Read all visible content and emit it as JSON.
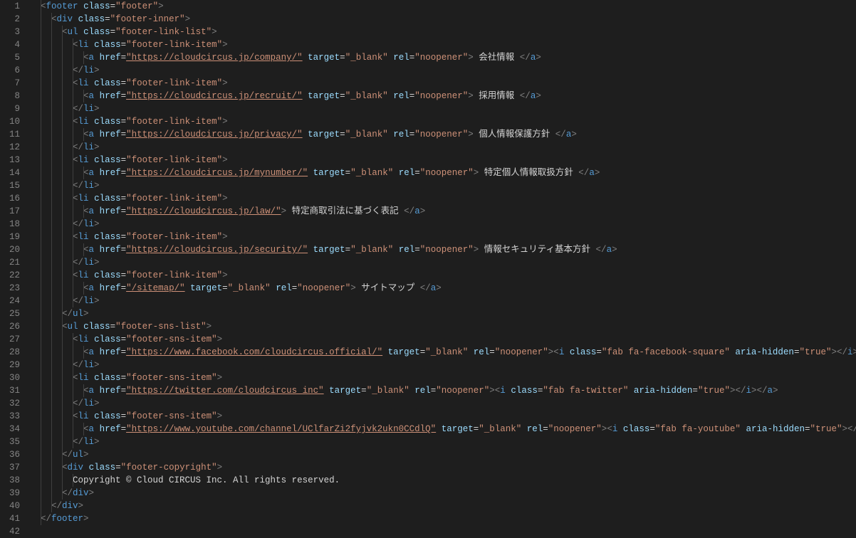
{
  "lines": [
    {
      "num": 1,
      "tokens": [
        {
          "t": "indent",
          "n": 1
        },
        {
          "t": "open",
          "tag": "footer",
          "attrs": [
            [
              "class",
              "footer"
            ]
          ]
        }
      ]
    },
    {
      "num": 2,
      "tokens": [
        {
          "t": "indent",
          "n": 2
        },
        {
          "t": "open",
          "tag": "div",
          "attrs": [
            [
              "class",
              "footer-inner"
            ]
          ]
        }
      ]
    },
    {
      "num": 3,
      "tokens": [
        {
          "t": "indent",
          "n": 3
        },
        {
          "t": "open",
          "tag": "ul",
          "attrs": [
            [
              "class",
              "footer-link-list"
            ]
          ]
        }
      ]
    },
    {
      "num": 4,
      "tokens": [
        {
          "t": "indent",
          "n": 4
        },
        {
          "t": "open",
          "tag": "li",
          "attrs": [
            [
              "class",
              "footer-link-item"
            ]
          ]
        }
      ]
    },
    {
      "num": 5,
      "tokens": [
        {
          "t": "indent",
          "n": 5
        },
        {
          "t": "open",
          "tag": "a",
          "attrs": [
            [
              "href",
              "https://cloudcircus.jp/company/",
              "u"
            ],
            [
              "target",
              "_blank"
            ],
            [
              "rel",
              "noopener"
            ]
          ]
        },
        {
          "t": "txt",
          "v": " 会社情報 "
        },
        {
          "t": "close",
          "tag": "a"
        }
      ]
    },
    {
      "num": 6,
      "tokens": [
        {
          "t": "indent",
          "n": 4
        },
        {
          "t": "close",
          "tag": "li"
        }
      ]
    },
    {
      "num": 7,
      "tokens": [
        {
          "t": "indent",
          "n": 4
        },
        {
          "t": "open",
          "tag": "li",
          "attrs": [
            [
              "class",
              "footer-link-item"
            ]
          ]
        }
      ]
    },
    {
      "num": 8,
      "tokens": [
        {
          "t": "indent",
          "n": 5
        },
        {
          "t": "open",
          "tag": "a",
          "attrs": [
            [
              "href",
              "https://cloudcircus.jp/recruit/",
              "u"
            ],
            [
              "target",
              "_blank"
            ],
            [
              "rel",
              "noopener"
            ]
          ]
        },
        {
          "t": "txt",
          "v": " 採用情報 "
        },
        {
          "t": "close",
          "tag": "a"
        }
      ]
    },
    {
      "num": 9,
      "tokens": [
        {
          "t": "indent",
          "n": 4
        },
        {
          "t": "close",
          "tag": "li"
        }
      ]
    },
    {
      "num": 10,
      "tokens": [
        {
          "t": "indent",
          "n": 4
        },
        {
          "t": "open",
          "tag": "li",
          "attrs": [
            [
              "class",
              "footer-link-item"
            ]
          ]
        }
      ]
    },
    {
      "num": 11,
      "tokens": [
        {
          "t": "indent",
          "n": 5
        },
        {
          "t": "open",
          "tag": "a",
          "attrs": [
            [
              "href",
              "https://cloudcircus.jp/privacy/",
              "u"
            ],
            [
              "target",
              "_blank"
            ],
            [
              "rel",
              "noopener"
            ]
          ]
        },
        {
          "t": "txt",
          "v": " 個人情報保護方針 "
        },
        {
          "t": "close",
          "tag": "a"
        }
      ]
    },
    {
      "num": 12,
      "tokens": [
        {
          "t": "indent",
          "n": 4
        },
        {
          "t": "close",
          "tag": "li"
        }
      ]
    },
    {
      "num": 13,
      "tokens": [
        {
          "t": "indent",
          "n": 4
        },
        {
          "t": "open",
          "tag": "li",
          "attrs": [
            [
              "class",
              "footer-link-item"
            ]
          ]
        }
      ]
    },
    {
      "num": 14,
      "tokens": [
        {
          "t": "indent",
          "n": 5
        },
        {
          "t": "open",
          "tag": "a",
          "attrs": [
            [
              "href",
              "https://cloudcircus.jp/mynumber/",
              "u"
            ],
            [
              "target",
              "_blank"
            ],
            [
              "rel",
              "noopener"
            ]
          ]
        },
        {
          "t": "txt",
          "v": " 特定個人情報取扱方針 "
        },
        {
          "t": "close",
          "tag": "a"
        }
      ]
    },
    {
      "num": 15,
      "tokens": [
        {
          "t": "indent",
          "n": 4
        },
        {
          "t": "close",
          "tag": "li"
        }
      ]
    },
    {
      "num": 16,
      "tokens": [
        {
          "t": "indent",
          "n": 4
        },
        {
          "t": "open",
          "tag": "li",
          "attrs": [
            [
              "class",
              "footer-link-item"
            ]
          ]
        }
      ]
    },
    {
      "num": 17,
      "tokens": [
        {
          "t": "indent",
          "n": 5
        },
        {
          "t": "open",
          "tag": "a",
          "attrs": [
            [
              "href",
              "https://cloudcircus.jp/law/",
              "u"
            ]
          ]
        },
        {
          "t": "txt",
          "v": " 特定商取引法に基づく表記 "
        },
        {
          "t": "close",
          "tag": "a"
        }
      ]
    },
    {
      "num": 18,
      "tokens": [
        {
          "t": "indent",
          "n": 4
        },
        {
          "t": "close",
          "tag": "li"
        }
      ]
    },
    {
      "num": 19,
      "tokens": [
        {
          "t": "indent",
          "n": 4
        },
        {
          "t": "open",
          "tag": "li",
          "attrs": [
            [
              "class",
              "footer-link-item"
            ]
          ]
        }
      ]
    },
    {
      "num": 20,
      "tokens": [
        {
          "t": "indent",
          "n": 5
        },
        {
          "t": "open",
          "tag": "a",
          "attrs": [
            [
              "href",
              "https://cloudcircus.jp/security/",
              "u"
            ],
            [
              "target",
              "_blank"
            ],
            [
              "rel",
              "noopener"
            ]
          ]
        },
        {
          "t": "txt",
          "v": " 情報セキュリティ基本方針 "
        },
        {
          "t": "close",
          "tag": "a"
        }
      ]
    },
    {
      "num": 21,
      "tokens": [
        {
          "t": "indent",
          "n": 4
        },
        {
          "t": "close",
          "tag": "li"
        }
      ]
    },
    {
      "num": 22,
      "tokens": [
        {
          "t": "indent",
          "n": 4
        },
        {
          "t": "open",
          "tag": "li",
          "attrs": [
            [
              "class",
              "footer-link-item"
            ]
          ]
        }
      ]
    },
    {
      "num": 23,
      "tokens": [
        {
          "t": "indent",
          "n": 5
        },
        {
          "t": "open",
          "tag": "a",
          "attrs": [
            [
              "href",
              "/sitemap/",
              "u"
            ],
            [
              "target",
              "_blank"
            ],
            [
              "rel",
              "noopener"
            ]
          ]
        },
        {
          "t": "txt",
          "v": " サイトマップ "
        },
        {
          "t": "close",
          "tag": "a"
        }
      ]
    },
    {
      "num": 24,
      "tokens": [
        {
          "t": "indent",
          "n": 4
        },
        {
          "t": "close",
          "tag": "li"
        }
      ]
    },
    {
      "num": 25,
      "tokens": [
        {
          "t": "indent",
          "n": 3
        },
        {
          "t": "close",
          "tag": "ul"
        }
      ]
    },
    {
      "num": 26,
      "tokens": [
        {
          "t": "indent",
          "n": 3
        },
        {
          "t": "open",
          "tag": "ul",
          "attrs": [
            [
              "class",
              "footer-sns-list"
            ]
          ]
        }
      ]
    },
    {
      "num": 27,
      "tokens": [
        {
          "t": "indent",
          "n": 4
        },
        {
          "t": "open",
          "tag": "li",
          "attrs": [
            [
              "class",
              "footer-sns-item"
            ]
          ]
        }
      ]
    },
    {
      "num": 28,
      "tokens": [
        {
          "t": "indent",
          "n": 5
        },
        {
          "t": "open",
          "tag": "a",
          "attrs": [
            [
              "href",
              "https://www.facebook.com/cloudcircus.official/",
              "u"
            ],
            [
              "target",
              "_blank"
            ],
            [
              "rel",
              "noopener"
            ]
          ]
        },
        {
          "t": "open",
          "tag": "i",
          "attrs": [
            [
              "class",
              "fab fa-facebook-square"
            ],
            [
              "aria-hidden",
              "true"
            ]
          ]
        },
        {
          "t": "close",
          "tag": "i"
        },
        {
          "t": "close",
          "tag": "a"
        }
      ]
    },
    {
      "num": 29,
      "tokens": [
        {
          "t": "indent",
          "n": 4
        },
        {
          "t": "close",
          "tag": "li"
        }
      ]
    },
    {
      "num": 30,
      "tokens": [
        {
          "t": "indent",
          "n": 4
        },
        {
          "t": "open",
          "tag": "li",
          "attrs": [
            [
              "class",
              "footer-sns-item"
            ]
          ]
        }
      ]
    },
    {
      "num": 31,
      "tokens": [
        {
          "t": "indent",
          "n": 5
        },
        {
          "t": "open",
          "tag": "a",
          "attrs": [
            [
              "href",
              "https://twitter.com/cloudcircus_inc",
              "u"
            ],
            [
              "target",
              "_blank"
            ],
            [
              "rel",
              "noopener"
            ]
          ]
        },
        {
          "t": "open",
          "tag": "i",
          "attrs": [
            [
              "class",
              "fab fa-twitter"
            ],
            [
              "aria-hidden",
              "true"
            ]
          ]
        },
        {
          "t": "close",
          "tag": "i"
        },
        {
          "t": "close",
          "tag": "a"
        }
      ]
    },
    {
      "num": 32,
      "tokens": [
        {
          "t": "indent",
          "n": 4
        },
        {
          "t": "close",
          "tag": "li"
        }
      ]
    },
    {
      "num": 33,
      "tokens": [
        {
          "t": "indent",
          "n": 4
        },
        {
          "t": "open",
          "tag": "li",
          "attrs": [
            [
              "class",
              "footer-sns-item"
            ]
          ]
        }
      ]
    },
    {
      "num": 34,
      "tokens": [
        {
          "t": "indent",
          "n": 5
        },
        {
          "t": "open",
          "tag": "a",
          "attrs": [
            [
              "href",
              "https://www.youtube.com/channel/UClfarZi2fyjvk2ukn0CCdlQ",
              "u"
            ],
            [
              "target",
              "_blank"
            ],
            [
              "rel",
              "noopener"
            ]
          ]
        },
        {
          "t": "open",
          "tag": "i",
          "attrs": [
            [
              "class",
              "fab fa-youtube"
            ],
            [
              "aria-hidden",
              "true"
            ]
          ]
        },
        {
          "t": "close",
          "tag": "i"
        },
        {
          "t": "close",
          "tag": "a"
        }
      ]
    },
    {
      "num": 35,
      "tokens": [
        {
          "t": "indent",
          "n": 4
        },
        {
          "t": "close",
          "tag": "li"
        }
      ]
    },
    {
      "num": 36,
      "tokens": [
        {
          "t": "indent",
          "n": 3
        },
        {
          "t": "close",
          "tag": "ul"
        }
      ]
    },
    {
      "num": 37,
      "tokens": [
        {
          "t": "indent",
          "n": 3
        },
        {
          "t": "open",
          "tag": "div",
          "attrs": [
            [
              "class",
              "footer-copyright"
            ]
          ]
        }
      ]
    },
    {
      "num": 38,
      "tokens": [
        {
          "t": "indent",
          "n": 4
        },
        {
          "t": "txt",
          "v": "Copyright © Cloud CIRCUS Inc. All rights reserved."
        }
      ]
    },
    {
      "num": 39,
      "tokens": [
        {
          "t": "indent",
          "n": 3
        },
        {
          "t": "close",
          "tag": "div"
        }
      ]
    },
    {
      "num": 40,
      "tokens": [
        {
          "t": "indent",
          "n": 2
        },
        {
          "t": "close",
          "tag": "div"
        }
      ]
    },
    {
      "num": 41,
      "tokens": [
        {
          "t": "indent",
          "n": 1
        },
        {
          "t": "close",
          "tag": "footer"
        }
      ]
    },
    {
      "num": 42,
      "tokens": []
    }
  ],
  "indentWidth": 2,
  "indentPx": 15
}
